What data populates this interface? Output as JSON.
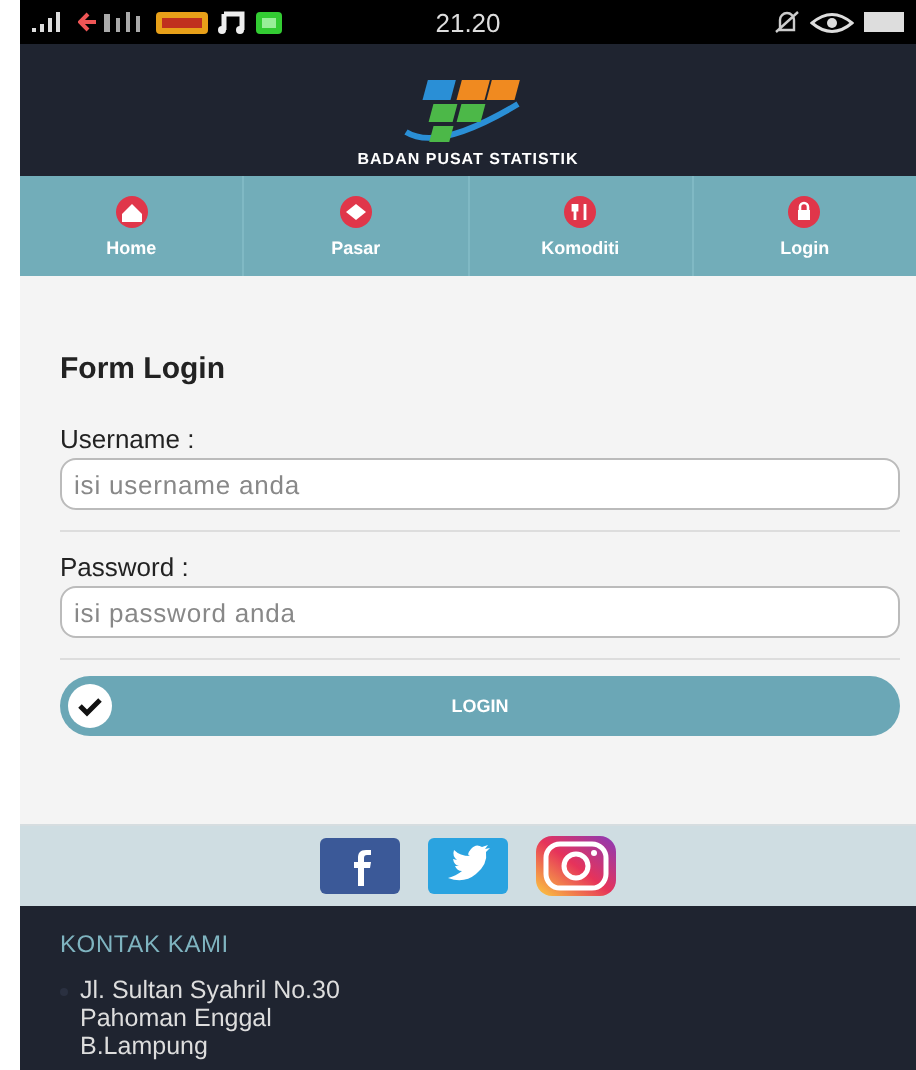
{
  "status_bar": {
    "time": "21.20"
  },
  "header": {
    "org_name": "BADAN PUSAT STATISTIK"
  },
  "nav": [
    {
      "label": "Home"
    },
    {
      "label": "Pasar"
    },
    {
      "label": "Komoditi"
    },
    {
      "label": "Login"
    }
  ],
  "form": {
    "title": "Form Login",
    "fields": [
      {
        "label": "Username :",
        "placeholder": "isi username anda"
      },
      {
        "label": "Password :",
        "placeholder": "isi password anda"
      }
    ],
    "button": "LOGIN"
  },
  "social": [
    {
      "kind": "facebook"
    },
    {
      "kind": "twitter"
    },
    {
      "kind": "instagram"
    }
  ],
  "footer": {
    "heading": "KONTAK KAMI",
    "address_lines": [
      "Jl. Sultan Syahril No.30",
      "Pahoman Enggal",
      "B.Lampung"
    ]
  }
}
